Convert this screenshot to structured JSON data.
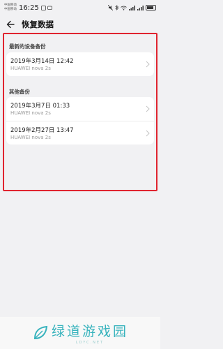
{
  "status_bar": {
    "carrier_line1": "中国移动",
    "carrier_line2": "中国移动",
    "time": "16:25",
    "battery_icon": "battery-icon"
  },
  "header": {
    "title": "恢复数据",
    "back_icon": "arrow-left-icon"
  },
  "sections": [
    {
      "title": "最新的设备备份",
      "items": [
        {
          "date": "2019年3月14日 12:42",
          "device": "HUAWEI nova 2s"
        }
      ]
    },
    {
      "title": "其他备份",
      "items": [
        {
          "date": "2019年3月7日 01:33",
          "device": "HUAWEI nova 2s"
        },
        {
          "date": "2019年2月27日 13:47",
          "device": "HUAWEI nova 2s"
        }
      ]
    }
  ],
  "watermark": {
    "text": "绿道游戏园",
    "subtext": "LDYC.NET"
  },
  "colors": {
    "highlight": "#e0242f",
    "background": "#f1f1f3",
    "brand": "#38b3bd"
  }
}
